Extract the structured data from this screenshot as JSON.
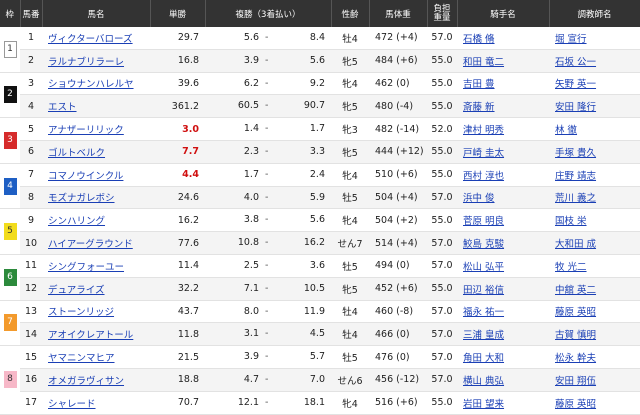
{
  "headers": [
    "枠",
    "馬番",
    "馬名",
    "単勝",
    "複勝（3着払い）",
    "性齢",
    "馬体重",
    "負担重量",
    "騎手名",
    "調教師名"
  ],
  "waku": [
    {
      "label": "1",
      "bg": "#ffffff",
      "fg": "#333333",
      "border": "#999999"
    },
    {
      "label": "2",
      "bg": "#111111",
      "fg": "#ffffff",
      "border": "#111111"
    },
    {
      "label": "3",
      "bg": "#d62b2b",
      "fg": "#ffffff",
      "border": "#d62b2b"
    },
    {
      "label": "4",
      "bg": "#1e5fc4",
      "fg": "#ffffff",
      "border": "#1e5fc4"
    },
    {
      "label": "5",
      "bg": "#f2dc1c",
      "fg": "#333333",
      "border": "#f2dc1c"
    },
    {
      "label": "6",
      "bg": "#2c8a3c",
      "fg": "#ffffff",
      "border": "#2c8a3c"
    },
    {
      "label": "7",
      "bg": "#f39a2c",
      "fg": "#ffffff",
      "border": "#f39a2c"
    },
    {
      "label": "8",
      "bg": "#f7b8c8",
      "fg": "#333333",
      "border": "#f7b8c8"
    }
  ],
  "horses": [
    {
      "waku": 0,
      "no": "1",
      "name": "ヴィクターバローズ",
      "win": "29.7",
      "hot": false,
      "pmin": "5.6",
      "pmax": "8.4",
      "sa": "牡4",
      "bw": "472 (+4)",
      "wt": "57.0",
      "jockey": "石橋 脩",
      "trainer": "堀 宣行"
    },
    {
      "waku": 0,
      "no": "2",
      "name": "ラルナブリラーレ",
      "win": "16.8",
      "hot": false,
      "pmin": "3.9",
      "pmax": "5.6",
      "sa": "牝5",
      "bw": "484 (+6)",
      "wt": "55.0",
      "jockey": "和田 竜二",
      "trainer": "石坂 公一"
    },
    {
      "waku": 1,
      "no": "3",
      "name": "ショウナンハレルヤ",
      "win": "39.6",
      "hot": false,
      "pmin": "6.2",
      "pmax": "9.2",
      "sa": "牝4",
      "bw": "462 (0)",
      "wt": "55.0",
      "jockey": "吉田 豊",
      "trainer": "矢野 英一"
    },
    {
      "waku": 1,
      "no": "4",
      "name": "エスト",
      "win": "361.2",
      "hot": false,
      "pmin": "60.5",
      "pmax": "90.7",
      "sa": "牝5",
      "bw": "480 (-4)",
      "wt": "55.0",
      "jockey": "斎藤 新",
      "trainer": "安田 隆行"
    },
    {
      "waku": 2,
      "no": "5",
      "name": "アナザーリリック",
      "win": "3.0",
      "hot": true,
      "pmin": "1.4",
      "pmax": "1.7",
      "sa": "牝3",
      "bw": "482 (-14)",
      "wt": "52.0",
      "jockey": "津村 明秀",
      "trainer": "林 徹"
    },
    {
      "waku": 2,
      "no": "6",
      "name": "ゴルトベルク",
      "win": "7.7",
      "hot": true,
      "pmin": "2.3",
      "pmax": "3.3",
      "sa": "牝5",
      "bw": "444 (+12)",
      "wt": "55.0",
      "jockey": "戸崎 圭太",
      "trainer": "手塚 貴久"
    },
    {
      "waku": 3,
      "no": "7",
      "name": "コマノウインクル",
      "win": "4.4",
      "hot": true,
      "pmin": "1.7",
      "pmax": "2.4",
      "sa": "牝4",
      "bw": "510 (+6)",
      "wt": "55.0",
      "jockey": "西村 淳也",
      "trainer": "庄野 靖志"
    },
    {
      "waku": 3,
      "no": "8",
      "name": "モズナガレボシ",
      "win": "24.6",
      "hot": false,
      "pmin": "4.0",
      "pmax": "5.9",
      "sa": "牡5",
      "bw": "504 (+4)",
      "wt": "57.0",
      "jockey": "浜中 俊",
      "trainer": "荒川 義之"
    },
    {
      "waku": 4,
      "no": "9",
      "name": "シンハリング",
      "win": "16.2",
      "hot": false,
      "pmin": "3.8",
      "pmax": "5.6",
      "sa": "牝4",
      "bw": "504 (+2)",
      "wt": "55.0",
      "jockey": "菅原 明良",
      "trainer": "国枝 栄"
    },
    {
      "waku": 4,
      "no": "10",
      "name": "ハイアーグラウンド",
      "win": "77.6",
      "hot": false,
      "pmin": "10.8",
      "pmax": "16.2",
      "sa": "せん7",
      "bw": "514 (+4)",
      "wt": "57.0",
      "jockey": "鮫島 克駿",
      "trainer": "大和田 成"
    },
    {
      "waku": 5,
      "no": "11",
      "name": "シングフォーユー",
      "win": "11.4",
      "hot": false,
      "pmin": "2.5",
      "pmax": "3.6",
      "sa": "牡5",
      "bw": "494 (0)",
      "wt": "57.0",
      "jockey": "松山 弘平",
      "trainer": "牧 光二"
    },
    {
      "waku": 5,
      "no": "12",
      "name": "デュアライズ",
      "win": "32.2",
      "hot": false,
      "pmin": "7.1",
      "pmax": "10.5",
      "sa": "牝5",
      "bw": "452 (+6)",
      "wt": "55.0",
      "jockey": "田辺 裕信",
      "trainer": "中舘 英二"
    },
    {
      "waku": 6,
      "no": "13",
      "name": "ストーンリッジ",
      "win": "43.7",
      "hot": false,
      "pmin": "8.0",
      "pmax": "11.9",
      "sa": "牡4",
      "bw": "460 (-8)",
      "wt": "57.0",
      "jockey": "福永 祐一",
      "trainer": "藤原 英昭"
    },
    {
      "waku": 6,
      "no": "14",
      "name": "アオイクレアトール",
      "win": "11.8",
      "hot": false,
      "pmin": "3.1",
      "pmax": "4.5",
      "sa": "牡4",
      "bw": "466 (0)",
      "wt": "57.0",
      "jockey": "三浦 皇成",
      "trainer": "古賀 慎明"
    },
    {
      "waku": 7,
      "no": "15",
      "name": "ヤマニンマヒア",
      "win": "21.5",
      "hot": false,
      "pmin": "3.9",
      "pmax": "5.7",
      "sa": "牡5",
      "bw": "476 (0)",
      "wt": "57.0",
      "jockey": "角田 大和",
      "trainer": "松永 幹夫"
    },
    {
      "waku": 7,
      "no": "16",
      "name": "オメガラヴィサン",
      "win": "18.8",
      "hot": false,
      "pmin": "4.7",
      "pmax": "7.0",
      "sa": "せん6",
      "bw": "456 (-12)",
      "wt": "57.0",
      "jockey": "横山 典弘",
      "trainer": "安田 翔伍"
    },
    {
      "waku": 7,
      "no": "17",
      "name": "シャレード",
      "win": "70.7",
      "hot": false,
      "pmin": "12.1",
      "pmax": "18.1",
      "sa": "牝4",
      "bw": "516 (+6)",
      "wt": "55.0",
      "jockey": "岩田 望来",
      "trainer": "藤原 英昭"
    }
  ]
}
